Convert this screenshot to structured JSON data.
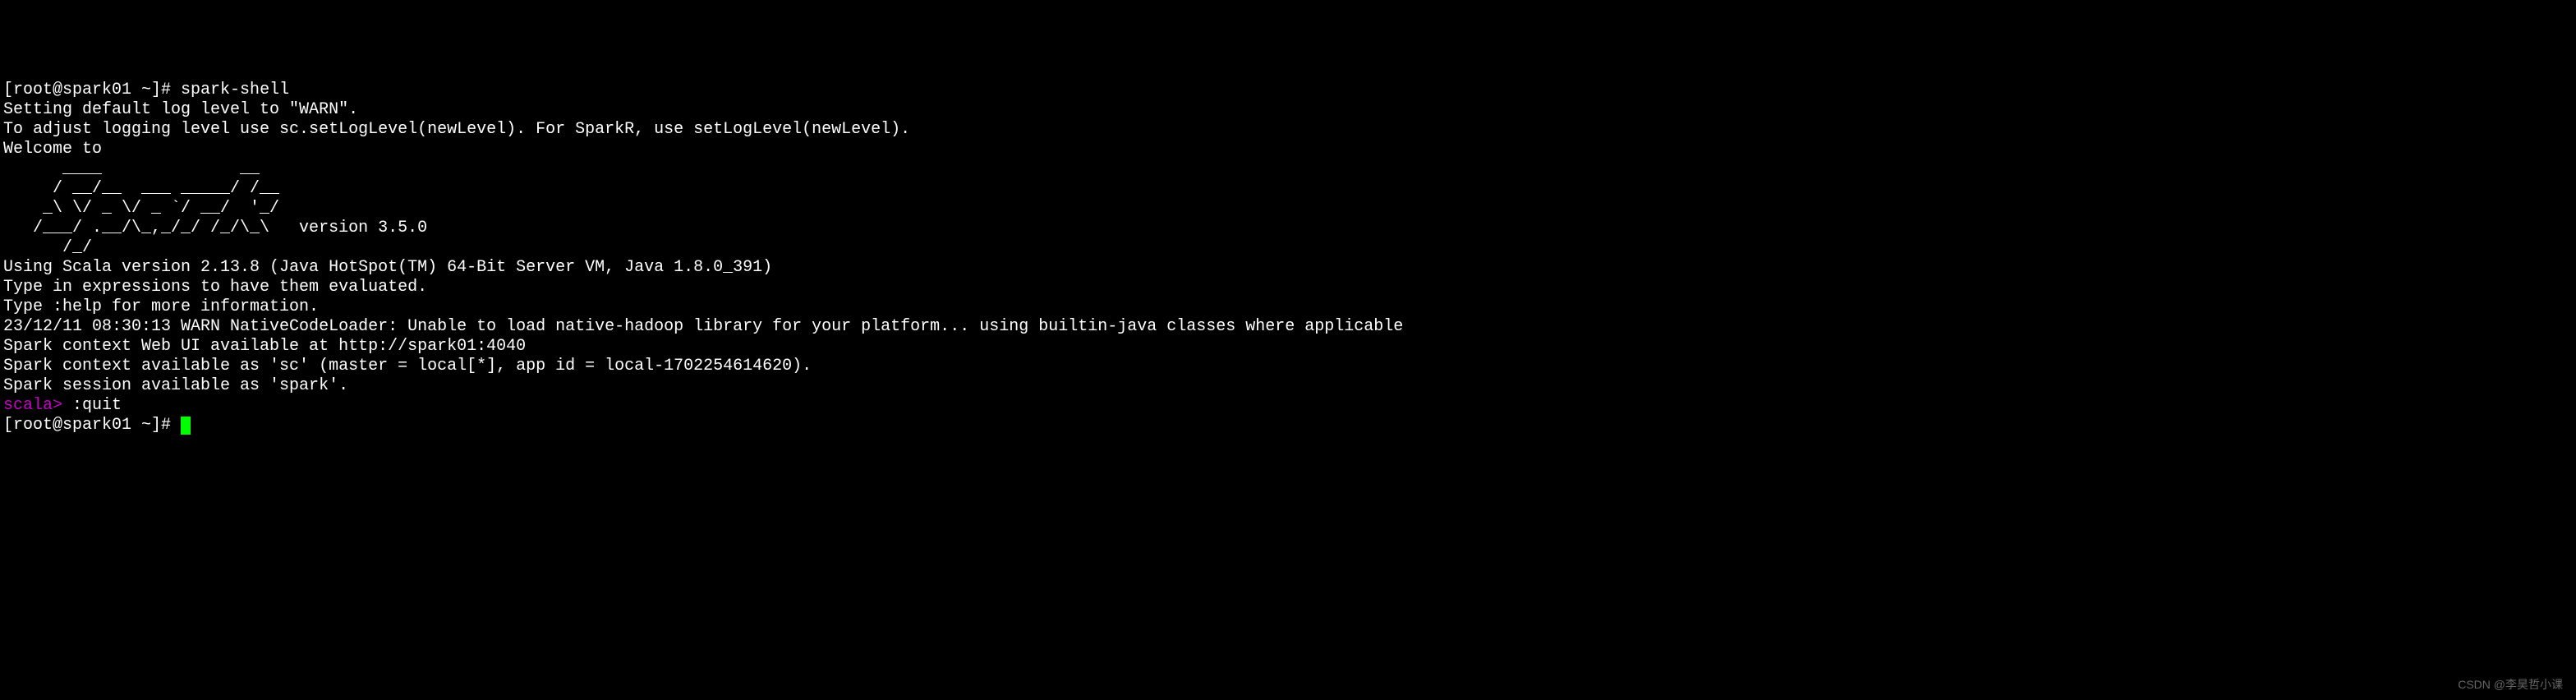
{
  "terminal": {
    "prompt1_bracket": "[root@spark01 ~]# ",
    "command1": "spark-shell",
    "line2": "Setting default log level to \"WARN\".",
    "line3": "To adjust logging level use sc.setLogLevel(newLevel). For SparkR, use setLogLevel(newLevel).",
    "line4": "Welcome to",
    "ascii1": "      ____              __",
    "ascii2": "     / __/__  ___ _____/ /__",
    "ascii3": "    _\\ \\/ _ \\/ _ `/ __/  '_/",
    "ascii4": "   /___/ .__/\\_,_/_/ /_/\\_\\   version 3.5.0",
    "ascii5": "      /_/",
    "line10": "",
    "line11": "Using Scala version 2.13.8 (Java HotSpot(TM) 64-Bit Server VM, Java 1.8.0_391)",
    "line12": "Type in expressions to have them evaluated.",
    "line13": "Type :help for more information.",
    "line14": "23/12/11 08:30:13 WARN NativeCodeLoader: Unable to load native-hadoop library for your platform... using builtin-java classes where applicable",
    "line15": "Spark context Web UI available at http://spark01:4040",
    "line16": "Spark context available as 'sc' (master = local[*], app id = local-1702254614620).",
    "line17": "Spark session available as 'spark'.",
    "line18": "",
    "scala_prompt": "scala> ",
    "scala_command": ":quit",
    "prompt2_bracket": "[root@spark01 ~]# "
  },
  "watermark": "CSDN @李昊哲小课"
}
